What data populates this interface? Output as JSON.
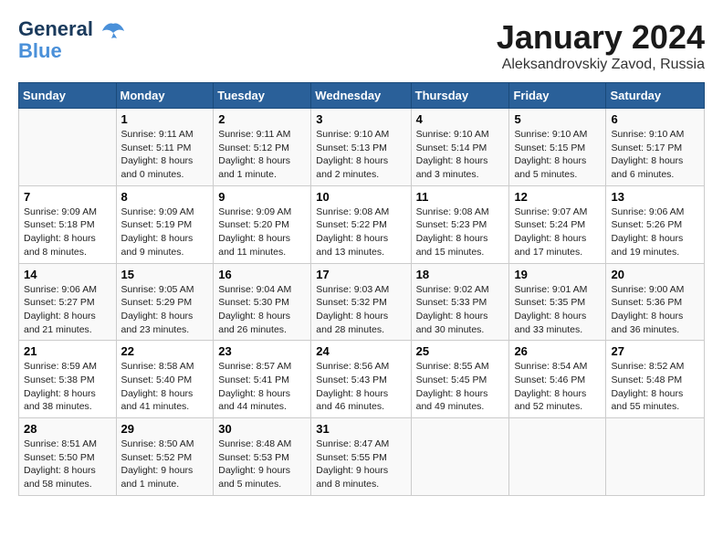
{
  "logo": {
    "line1": "General",
    "line2": "Blue"
  },
  "title": "January 2024",
  "subtitle": "Aleksandrovskiy Zavod, Russia",
  "days_header": [
    "Sunday",
    "Monday",
    "Tuesday",
    "Wednesday",
    "Thursday",
    "Friday",
    "Saturday"
  ],
  "weeks": [
    [
      {
        "num": "",
        "sunrise": "",
        "sunset": "",
        "daylight": ""
      },
      {
        "num": "1",
        "sunrise": "Sunrise: 9:11 AM",
        "sunset": "Sunset: 5:11 PM",
        "daylight": "Daylight: 8 hours and 0 minutes."
      },
      {
        "num": "2",
        "sunrise": "Sunrise: 9:11 AM",
        "sunset": "Sunset: 5:12 PM",
        "daylight": "Daylight: 8 hours and 1 minute."
      },
      {
        "num": "3",
        "sunrise": "Sunrise: 9:10 AM",
        "sunset": "Sunset: 5:13 PM",
        "daylight": "Daylight: 8 hours and 2 minutes."
      },
      {
        "num": "4",
        "sunrise": "Sunrise: 9:10 AM",
        "sunset": "Sunset: 5:14 PM",
        "daylight": "Daylight: 8 hours and 3 minutes."
      },
      {
        "num": "5",
        "sunrise": "Sunrise: 9:10 AM",
        "sunset": "Sunset: 5:15 PM",
        "daylight": "Daylight: 8 hours and 5 minutes."
      },
      {
        "num": "6",
        "sunrise": "Sunrise: 9:10 AM",
        "sunset": "Sunset: 5:17 PM",
        "daylight": "Daylight: 8 hours and 6 minutes."
      }
    ],
    [
      {
        "num": "7",
        "sunrise": "Sunrise: 9:09 AM",
        "sunset": "Sunset: 5:18 PM",
        "daylight": "Daylight: 8 hours and 8 minutes."
      },
      {
        "num": "8",
        "sunrise": "Sunrise: 9:09 AM",
        "sunset": "Sunset: 5:19 PM",
        "daylight": "Daylight: 8 hours and 9 minutes."
      },
      {
        "num": "9",
        "sunrise": "Sunrise: 9:09 AM",
        "sunset": "Sunset: 5:20 PM",
        "daylight": "Daylight: 8 hours and 11 minutes."
      },
      {
        "num": "10",
        "sunrise": "Sunrise: 9:08 AM",
        "sunset": "Sunset: 5:22 PM",
        "daylight": "Daylight: 8 hours and 13 minutes."
      },
      {
        "num": "11",
        "sunrise": "Sunrise: 9:08 AM",
        "sunset": "Sunset: 5:23 PM",
        "daylight": "Daylight: 8 hours and 15 minutes."
      },
      {
        "num": "12",
        "sunrise": "Sunrise: 9:07 AM",
        "sunset": "Sunset: 5:24 PM",
        "daylight": "Daylight: 8 hours and 17 minutes."
      },
      {
        "num": "13",
        "sunrise": "Sunrise: 9:06 AM",
        "sunset": "Sunset: 5:26 PM",
        "daylight": "Daylight: 8 hours and 19 minutes."
      }
    ],
    [
      {
        "num": "14",
        "sunrise": "Sunrise: 9:06 AM",
        "sunset": "Sunset: 5:27 PM",
        "daylight": "Daylight: 8 hours and 21 minutes."
      },
      {
        "num": "15",
        "sunrise": "Sunrise: 9:05 AM",
        "sunset": "Sunset: 5:29 PM",
        "daylight": "Daylight: 8 hours and 23 minutes."
      },
      {
        "num": "16",
        "sunrise": "Sunrise: 9:04 AM",
        "sunset": "Sunset: 5:30 PM",
        "daylight": "Daylight: 8 hours and 26 minutes."
      },
      {
        "num": "17",
        "sunrise": "Sunrise: 9:03 AM",
        "sunset": "Sunset: 5:32 PM",
        "daylight": "Daylight: 8 hours and 28 minutes."
      },
      {
        "num": "18",
        "sunrise": "Sunrise: 9:02 AM",
        "sunset": "Sunset: 5:33 PM",
        "daylight": "Daylight: 8 hours and 30 minutes."
      },
      {
        "num": "19",
        "sunrise": "Sunrise: 9:01 AM",
        "sunset": "Sunset: 5:35 PM",
        "daylight": "Daylight: 8 hours and 33 minutes."
      },
      {
        "num": "20",
        "sunrise": "Sunrise: 9:00 AM",
        "sunset": "Sunset: 5:36 PM",
        "daylight": "Daylight: 8 hours and 36 minutes."
      }
    ],
    [
      {
        "num": "21",
        "sunrise": "Sunrise: 8:59 AM",
        "sunset": "Sunset: 5:38 PM",
        "daylight": "Daylight: 8 hours and 38 minutes."
      },
      {
        "num": "22",
        "sunrise": "Sunrise: 8:58 AM",
        "sunset": "Sunset: 5:40 PM",
        "daylight": "Daylight: 8 hours and 41 minutes."
      },
      {
        "num": "23",
        "sunrise": "Sunrise: 8:57 AM",
        "sunset": "Sunset: 5:41 PM",
        "daylight": "Daylight: 8 hours and 44 minutes."
      },
      {
        "num": "24",
        "sunrise": "Sunrise: 8:56 AM",
        "sunset": "Sunset: 5:43 PM",
        "daylight": "Daylight: 8 hours and 46 minutes."
      },
      {
        "num": "25",
        "sunrise": "Sunrise: 8:55 AM",
        "sunset": "Sunset: 5:45 PM",
        "daylight": "Daylight: 8 hours and 49 minutes."
      },
      {
        "num": "26",
        "sunrise": "Sunrise: 8:54 AM",
        "sunset": "Sunset: 5:46 PM",
        "daylight": "Daylight: 8 hours and 52 minutes."
      },
      {
        "num": "27",
        "sunrise": "Sunrise: 8:52 AM",
        "sunset": "Sunset: 5:48 PM",
        "daylight": "Daylight: 8 hours and 55 minutes."
      }
    ],
    [
      {
        "num": "28",
        "sunrise": "Sunrise: 8:51 AM",
        "sunset": "Sunset: 5:50 PM",
        "daylight": "Daylight: 8 hours and 58 minutes."
      },
      {
        "num": "29",
        "sunrise": "Sunrise: 8:50 AM",
        "sunset": "Sunset: 5:52 PM",
        "daylight": "Daylight: 9 hours and 1 minute."
      },
      {
        "num": "30",
        "sunrise": "Sunrise: 8:48 AM",
        "sunset": "Sunset: 5:53 PM",
        "daylight": "Daylight: 9 hours and 5 minutes."
      },
      {
        "num": "31",
        "sunrise": "Sunrise: 8:47 AM",
        "sunset": "Sunset: 5:55 PM",
        "daylight": "Daylight: 9 hours and 8 minutes."
      },
      {
        "num": "",
        "sunrise": "",
        "sunset": "",
        "daylight": ""
      },
      {
        "num": "",
        "sunrise": "",
        "sunset": "",
        "daylight": ""
      },
      {
        "num": "",
        "sunrise": "",
        "sunset": "",
        "daylight": ""
      }
    ]
  ]
}
